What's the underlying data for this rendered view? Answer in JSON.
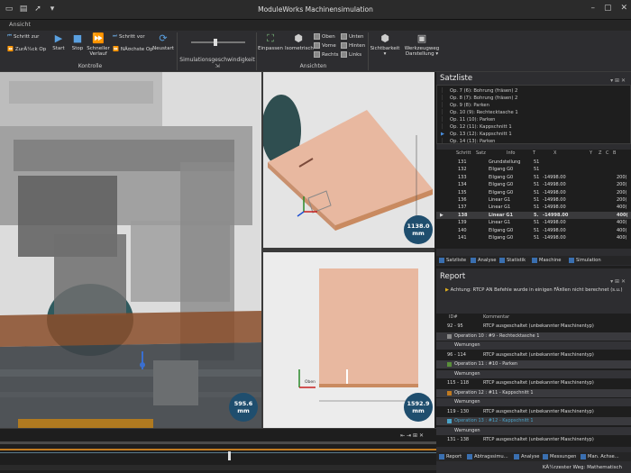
{
  "window": {
    "title": "ModuleWorks Machinensimulation",
    "menu": "Ansicht"
  },
  "ribbon": {
    "kontrolle": {
      "label": "Kontrolle",
      "back": "Schritt zur",
      "return": "ZurÃ¼ck Op",
      "start": "Start",
      "stop": "Stop",
      "fast_1": "Schneller",
      "fast_2": "Verlauf",
      "fwd": "Schritt vor",
      "next": "NÃ¤chste Op",
      "restart": "Neustart"
    },
    "speed_label": "Simulationsgeschwindigkeit",
    "speed_value": 0.45,
    "views": {
      "label": "Ansichten",
      "fit": "Einpassen",
      "iso": "Isometrisch",
      "top": "Oben",
      "front": "Vorne",
      "right": "Rechts",
      "bottom": "Unten",
      "back": "Hinten",
      "left": "Links"
    },
    "visibility": "Sichtbarkeit",
    "toolpath_1": "Werkzeugweg",
    "toolpath_2": "Darstellung"
  },
  "viewports": {
    "main_measure": [
      "595.6",
      "mm"
    ],
    "top_right_measure": [
      "1138.0",
      "mm"
    ],
    "bottom_right_measure": [
      "1592.9",
      "mm"
    ],
    "axis_label": "Oben"
  },
  "satzliste": {
    "title": "Satzliste",
    "ops": [
      "Op. 7 (6): Bohrung (fräsen) 2",
      "Op. 8 (7): Bohrung (fräsen) 2",
      "Op. 9 (8): Parken",
      "Op. 10 (9): Rechtecktasche 1",
      "Op. 11 (10): Parken",
      "Op. 12 (11): Kappschnitt 1",
      "Op. 13 (12): Kappschnitt 1",
      "Op. 14 (13): Parken"
    ],
    "active_op": 6,
    "columns": [
      "Schritt",
      "Satz",
      "Info",
      "T",
      "X",
      "Y",
      "Z",
      "C",
      "B"
    ],
    "rows": [
      [
        "131",
        "",
        "Grundstellung",
        "51",
        "",
        ""
      ],
      [
        "132",
        "",
        "Eilgang G0",
        "51",
        "",
        ""
      ],
      [
        "133",
        "",
        "Eilgang G0",
        "51",
        "-14998.00",
        "200("
      ],
      [
        "134",
        "",
        "Eilgang G0",
        "51",
        "-14998.00",
        "200("
      ],
      [
        "135",
        "",
        "Eilgang G0",
        "51",
        "-14998.00",
        "200("
      ],
      [
        "136",
        "",
        "Linear G1",
        "51",
        "-14998.00",
        "200("
      ],
      [
        "137",
        "",
        "Linear G1",
        "51",
        "-14998.00",
        "400("
      ],
      [
        "138",
        "",
        "Linear G1",
        "5.",
        "-14998.00",
        "400("
      ],
      [
        "139",
        "",
        "Linear G1",
        "51",
        "-14998.00",
        "400("
      ],
      [
        "140",
        "",
        "Eilgang G0",
        "51",
        "-14998.00",
        "400("
      ],
      [
        "141",
        "",
        "Eilgang G0",
        "51",
        "-14998.00",
        "400("
      ]
    ],
    "current_row": 7,
    "tabs": [
      "Satzliste",
      "Analyse",
      "Statistik",
      "Maschine",
      "Simulation"
    ]
  },
  "report": {
    "title": "Report",
    "warning": "Achtung: RTCP AN Befehle wurde in einigen FÃ¤llen nicht berechnet (s.u.)",
    "columns": [
      "ID#",
      "Kommentar"
    ],
    "rows": [
      {
        "type": "entry",
        "id": "92 - 95",
        "text": "RTCP ausgeschaltet (unbekannter Maschinentyp)"
      },
      {
        "type": "op",
        "text": "Operation 10 : #9 - Rechtecktasche 1",
        "color": "#888888"
      },
      {
        "type": "sub",
        "text": "Warnungen"
      },
      {
        "type": "entry",
        "id": "96 - 114",
        "text": "RTCP ausgeschaltet (unbekannter Maschinentyp)"
      },
      {
        "type": "op",
        "text": "Operation 11 : #10 - Parken",
        "color": "#5a8f3a"
      },
      {
        "type": "sub",
        "text": "Warnungen"
      },
      {
        "type": "entry",
        "id": "115 - 118",
        "text": "RTCP ausgeschaltet (unbekannter Maschinentyp)"
      },
      {
        "type": "op",
        "text": "Operation 12 : #11 - Kappschnitt 1",
        "color": "#c07a20"
      },
      {
        "type": "sub",
        "text": "Warnungen"
      },
      {
        "type": "entry",
        "id": "119 - 130",
        "text": "RTCP ausgeschaltet (unbekannter Maschinentyp)"
      },
      {
        "type": "op_active",
        "text": "Operation 13 : #12 - Kappschnitt 1",
        "color": "#4aa3c8"
      },
      {
        "type": "sub",
        "text": "Warnungen"
      },
      {
        "type": "entry",
        "id": "131 - 138",
        "text": "RTCP ausgeschaltet (unbekannter Maschinentyp)"
      }
    ],
    "tabs": [
      "Report",
      "Abtragssimu...",
      "Analyse",
      "Messungen",
      "Man. Achse..."
    ]
  },
  "status": "KÃ¼rzester Weg: Mathematisch",
  "colors": {
    "accent": "#1f4e6e",
    "board": "#e8b8a0"
  }
}
